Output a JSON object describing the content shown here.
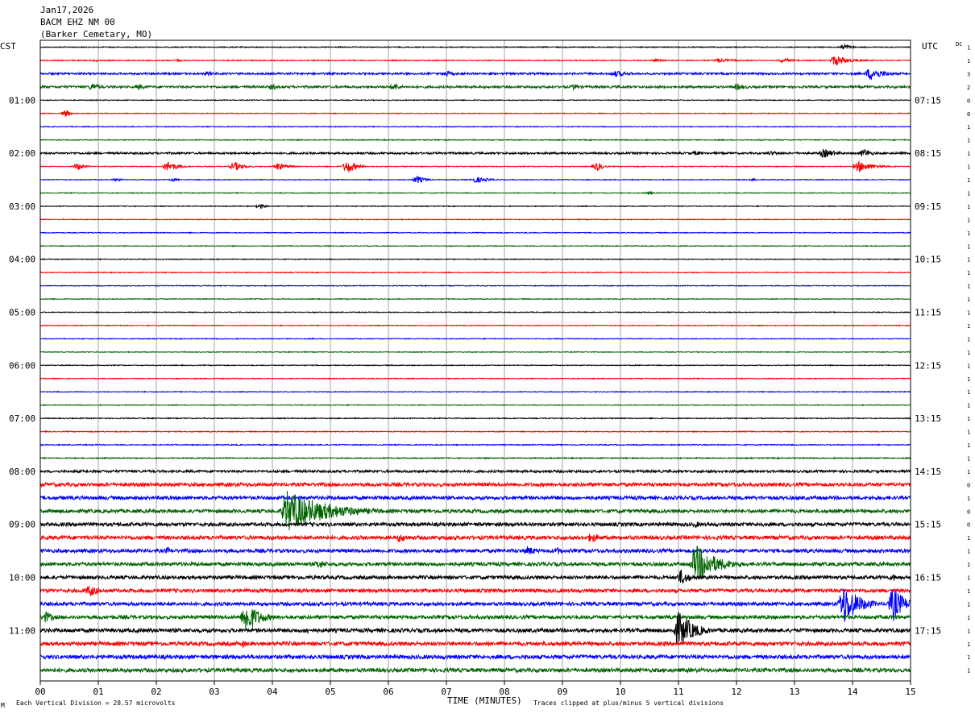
{
  "header": {
    "date": "Jan17,2026",
    "station": "BACM EHZ NM 00",
    "location": "(Barker Cemetary, MO)"
  },
  "timezones": {
    "left": "CST",
    "right": "UTC"
  },
  "dc_header": "DC",
  "footer": {
    "division_note": "Each Vertical Division =   28.57 microvolts",
    "clip_note": "Traces clipped at plus/minus 5 vertical divisions",
    "corner_mark": "M"
  },
  "colors": [
    "#000000",
    "#ff0000",
    "#0000ff",
    "#006400"
  ],
  "chart_data": {
    "type": "helicorder",
    "xlabel": "TIME (MINUTES)",
    "xlim": [
      0,
      15
    ],
    "x_ticks": [
      "00",
      "01",
      "02",
      "03",
      "04",
      "05",
      "06",
      "07",
      "08",
      "09",
      "10",
      "11",
      "12",
      "13",
      "14",
      "15"
    ],
    "grid": true,
    "line_count": 48,
    "minutes_per_line": 15,
    "left_hour_labels": [
      "01:00",
      "02:00",
      "03:00",
      "04:00",
      "05:00",
      "06:00",
      "07:00",
      "08:00",
      "09:00",
      "10:00",
      "11:00"
    ],
    "right_hour_labels": [
      "07:15",
      "08:15",
      "09:15",
      "10:15",
      "11:15",
      "12:15",
      "13:15",
      "14:15",
      "15:15",
      "16:15",
      "17:15"
    ],
    "dc_values": [
      "1",
      "1",
      "3",
      "2",
      "0",
      "0",
      "1",
      "1",
      "1",
      "1",
      "1",
      "1",
      "1",
      "1",
      "1",
      "1",
      "1",
      "1",
      "1",
      "1",
      "1",
      "1",
      "1",
      "1",
      "1",
      "1",
      "1",
      "1",
      "1",
      "1",
      "1",
      "1",
      "1",
      "0",
      "1",
      "0",
      "0",
      "1",
      "1",
      "1",
      "1",
      "1",
      "1",
      "1",
      "1",
      "1",
      "1",
      "1"
    ],
    "noise_levels": [
      0.6,
      0.6,
      1.2,
      1.4,
      0.5,
      0.5,
      0.5,
      0.6,
      1.2,
      0.5,
      0.5,
      0.5,
      0.5,
      0.5,
      0.5,
      0.5,
      0.5,
      0.5,
      0.5,
      0.5,
      0.5,
      0.5,
      0.5,
      0.5,
      0.5,
      0.5,
      0.5,
      0.5,
      0.6,
      0.6,
      0.6,
      0.7,
      1.5,
      2.2,
      2.2,
      2.2,
      2.2,
      2.4,
      2.2,
      2.2,
      2.2,
      2.2,
      2.2,
      2.2,
      2.4,
      2.4,
      2.4,
      2.4
    ],
    "events": [
      {
        "line": 0,
        "minute": 13.85,
        "amplitude": 4,
        "duration": 0.4
      },
      {
        "line": 1,
        "minute": 0.95,
        "amplitude": 2,
        "duration": 0.15
      },
      {
        "line": 1,
        "minute": 2.4,
        "amplitude": 2,
        "duration": 0.15
      },
      {
        "line": 1,
        "minute": 10.6,
        "amplitude": 2,
        "duration": 0.5
      },
      {
        "line": 1,
        "minute": 11.7,
        "amplitude": 3,
        "duration": 0.8
      },
      {
        "line": 1,
        "minute": 12.8,
        "amplitude": 3,
        "duration": 0.6
      },
      {
        "line": 1,
        "minute": 13.7,
        "amplitude": 7,
        "duration": 0.7
      },
      {
        "line": 2,
        "minute": 2.9,
        "amplitude": 3,
        "duration": 0.4
      },
      {
        "line": 2,
        "minute": 7.0,
        "amplitude": 4,
        "duration": 0.4
      },
      {
        "line": 2,
        "minute": 9.9,
        "amplitude": 4,
        "duration": 0.9
      },
      {
        "line": 2,
        "minute": 14.3,
        "amplitude": 8,
        "duration": 0.8
      },
      {
        "line": 3,
        "minute": 0.9,
        "amplitude": 5,
        "duration": 0.4
      },
      {
        "line": 3,
        "minute": 1.7,
        "amplitude": 4,
        "duration": 0.4
      },
      {
        "line": 3,
        "minute": 4.0,
        "amplitude": 4,
        "duration": 0.4
      },
      {
        "line": 3,
        "minute": 6.1,
        "amplitude": 5,
        "duration": 0.4
      },
      {
        "line": 3,
        "minute": 9.2,
        "amplitude": 4,
        "duration": 0.4
      },
      {
        "line": 3,
        "minute": 12.0,
        "amplitude": 4,
        "duration": 0.7
      },
      {
        "line": 5,
        "minute": 0.45,
        "amplitude": 5,
        "duration": 0.2
      },
      {
        "line": 8,
        "minute": 11.3,
        "amplitude": 3,
        "duration": 0.5
      },
      {
        "line": 8,
        "minute": 12.6,
        "amplitude": 3,
        "duration": 0.6
      },
      {
        "line": 8,
        "minute": 13.5,
        "amplitude": 6,
        "duration": 0.7
      },
      {
        "line": 8,
        "minute": 14.2,
        "amplitude": 6,
        "duration": 0.4
      },
      {
        "line": 9,
        "minute": 0.65,
        "amplitude": 5,
        "duration": 0.3
      },
      {
        "line": 9,
        "minute": 2.2,
        "amplitude": 7,
        "duration": 0.5
      },
      {
        "line": 9,
        "minute": 3.35,
        "amplitude": 6,
        "duration": 0.5
      },
      {
        "line": 9,
        "minute": 4.1,
        "amplitude": 5,
        "duration": 0.5
      },
      {
        "line": 9,
        "minute": 5.3,
        "amplitude": 9,
        "duration": 0.4
      },
      {
        "line": 9,
        "minute": 9.6,
        "amplitude": 6,
        "duration": 0.3
      },
      {
        "line": 9,
        "minute": 14.1,
        "amplitude": 7,
        "duration": 0.8
      },
      {
        "line": 10,
        "minute": 1.3,
        "amplitude": 2,
        "duration": 0.4
      },
      {
        "line": 10,
        "minute": 2.3,
        "amplitude": 2,
        "duration": 0.3
      },
      {
        "line": 10,
        "minute": 6.5,
        "amplitude": 5,
        "duration": 0.4
      },
      {
        "line": 10,
        "minute": 7.5,
        "amplitude": 4,
        "duration": 0.7
      },
      {
        "line": 10,
        "minute": 12.3,
        "amplitude": 2,
        "duration": 0.2
      },
      {
        "line": 11,
        "minute": 10.5,
        "amplitude": 2,
        "duration": 0.2
      },
      {
        "line": 12,
        "minute": 3.8,
        "amplitude": 3,
        "duration": 0.3
      },
      {
        "line": 27,
        "minute": 2.6,
        "amplitude": 1,
        "duration": 0.2
      },
      {
        "line": 35,
        "minute": 4.25,
        "amplitude": 26,
        "duration": 2.1
      },
      {
        "line": 36,
        "minute": 7.0,
        "amplitude": 3,
        "duration": 0.3
      },
      {
        "line": 36,
        "minute": 11.3,
        "amplitude": 4,
        "duration": 0.4
      },
      {
        "line": 36,
        "minute": 12.4,
        "amplitude": 4,
        "duration": 0.4
      },
      {
        "line": 37,
        "minute": 6.2,
        "amplitude": 6,
        "duration": 0.6
      },
      {
        "line": 37,
        "minute": 9.5,
        "amplitude": 7,
        "duration": 0.5
      },
      {
        "line": 38,
        "minute": 2.2,
        "amplitude": 5,
        "duration": 0.3
      },
      {
        "line": 38,
        "minute": 8.4,
        "amplitude": 6,
        "duration": 0.6
      },
      {
        "line": 38,
        "minute": 8.9,
        "amplitude": 5,
        "duration": 0.5
      },
      {
        "line": 39,
        "minute": 4.8,
        "amplitude": 6,
        "duration": 0.6
      },
      {
        "line": 39,
        "minute": 11.3,
        "amplitude": 24,
        "duration": 1.1
      },
      {
        "line": 40,
        "minute": 11.05,
        "amplitude": 10,
        "duration": 0.5
      },
      {
        "line": 40,
        "minute": 14.7,
        "amplitude": 5,
        "duration": 0.3
      },
      {
        "line": 41,
        "minute": 0.85,
        "amplitude": 8,
        "duration": 0.5
      },
      {
        "line": 42,
        "minute": 13.85,
        "amplitude": 26,
        "duration": 0.8
      },
      {
        "line": 42,
        "minute": 14.7,
        "amplitude": 22,
        "duration": 0.6
      },
      {
        "line": 43,
        "minute": 0.1,
        "amplitude": 8,
        "duration": 0.4
      },
      {
        "line": 43,
        "minute": 3.55,
        "amplitude": 20,
        "duration": 0.7
      },
      {
        "line": 44,
        "minute": 4.6,
        "amplitude": 5,
        "duration": 0.2
      },
      {
        "line": 44,
        "minute": 11.0,
        "amplitude": 24,
        "duration": 0.8
      },
      {
        "line": 45,
        "minute": 3.5,
        "amplitude": 5,
        "duration": 0.3
      }
    ]
  }
}
